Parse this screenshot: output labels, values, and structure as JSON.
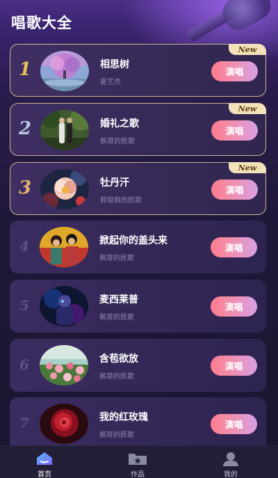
{
  "header": {
    "title": "唱歌大全"
  },
  "songs": [
    {
      "rank": "1",
      "name": "相思树",
      "artist": "夏艺杰",
      "action": "演唱",
      "badge": "New"
    },
    {
      "rank": "2",
      "name": "婚礼之歌",
      "artist": "枫哥的民歌",
      "action": "演唱",
      "badge": "New"
    },
    {
      "rank": "3",
      "name": "牡丹汗",
      "artist": "郭俊枫的民歌",
      "action": "演唱",
      "badge": "New"
    },
    {
      "rank": "4",
      "name": "掀起你的盖头来",
      "artist": "枫哥的民歌",
      "action": "演唱"
    },
    {
      "rank": "5",
      "name": "麦西莱普",
      "artist": "枫哥的民歌",
      "action": "演唱"
    },
    {
      "rank": "6",
      "name": "含苞欲放",
      "artist": "枫哥的民歌",
      "action": "演唱"
    },
    {
      "rank": "7",
      "name": "我的红玫瑰",
      "artist": "枫哥的民歌",
      "action": "演唱"
    }
  ],
  "tabbar": {
    "home": {
      "label": "首页",
      "icon": "home-icon"
    },
    "works": {
      "label": "作品",
      "icon": "folder-star-icon"
    },
    "mine": {
      "label": "我的",
      "icon": "person-icon"
    }
  },
  "colors": {
    "accent_button_start": "#ff7c8e",
    "accent_button_end": "#d8a0e6",
    "gold_border": "#cdb591",
    "badge_bg": "#f3e2b9"
  }
}
